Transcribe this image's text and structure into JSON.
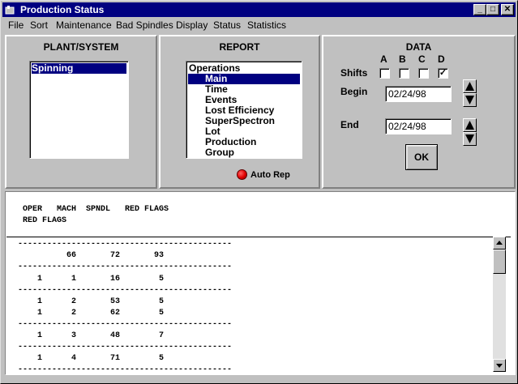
{
  "window": {
    "title": "Production Status",
    "minimize": "_",
    "maximize": "□",
    "close": "✕"
  },
  "menu": [
    "File",
    "Sort",
    "Maintenance",
    "Bad Spindles",
    "Display",
    "Status",
    "Statistics"
  ],
  "plant": {
    "title": "PLANT/SYSTEM",
    "items": [
      "Spinning"
    ],
    "selected": "Spinning"
  },
  "report": {
    "title": "REPORT",
    "items": [
      "Operations",
      "Main",
      "Time",
      "Events",
      "Lost Efficiency",
      "SuperSpectron",
      "Lot",
      "Production",
      "Group"
    ],
    "selected": "Main",
    "auto_rep_label": "Auto Rep"
  },
  "data": {
    "title": "DATA",
    "shifts_label": "Shifts",
    "shifts": [
      {
        "label": "A",
        "checked": false
      },
      {
        "label": "B",
        "checked": false
      },
      {
        "label": "C",
        "checked": false
      },
      {
        "label": "D",
        "checked": true
      }
    ],
    "checkmark": "✓",
    "begin_label": "Begin",
    "begin_value": "02/24/98",
    "end_label": "End",
    "end_value": "02/24/98",
    "ok_label": "OK"
  },
  "output": {
    "header_line1": "OPER   MACH  SPNDL   RED FLAGS",
    "header_line2": "RED FLAGS",
    "lines": [
      "--------------------------------------------",
      "          66       72       93",
      "--------------------------------------------",
      "    1      1       16        5",
      "--------------------------------------------",
      "    1      2       53        5",
      "    1      2       62        5",
      "--------------------------------------------",
      "    1      3       48        7",
      "--------------------------------------------",
      "    1      4       71        5",
      "--------------------------------------------"
    ]
  },
  "colors": {
    "selection": "#000080",
    "titlebar": "#000080",
    "face": "#c0c0c0",
    "led": "#e00000"
  }
}
